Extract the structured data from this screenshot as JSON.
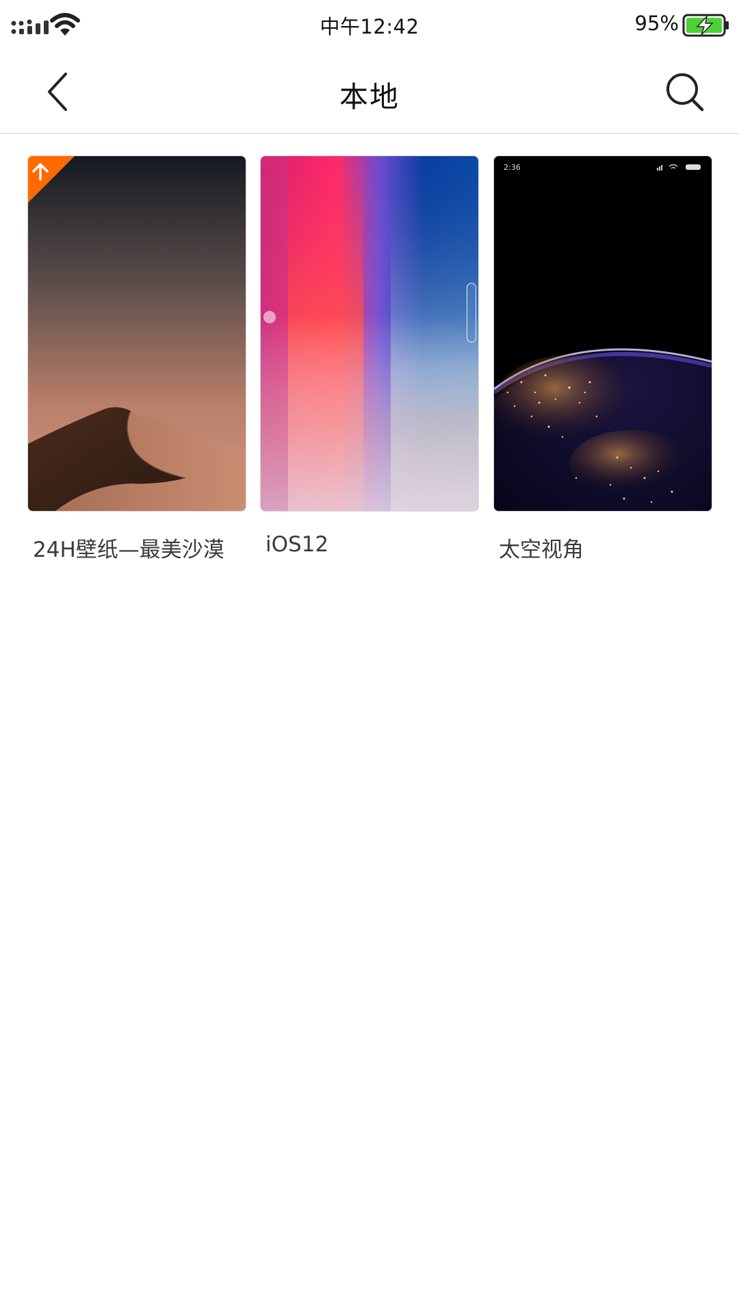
{
  "status_bar": {
    "time": "中午12:42",
    "battery_percent": "95%",
    "icons": [
      "signal-icon",
      "wifi-icon",
      "battery-charging-icon"
    ]
  },
  "nav": {
    "title": "本地",
    "icons": [
      "chevron-left-icon",
      "search-icon"
    ]
  },
  "wallpapers": [
    {
      "title": "24H壁纸—最美沙漠",
      "badge_icon": "arrow-up-icon"
    },
    {
      "title": "iOS12"
    },
    {
      "title": "太空视角",
      "preview_time": "2:36"
    }
  ],
  "colors": {
    "badge": "#ff6a00",
    "battery_fill": "#4cd137",
    "text": "#3a3a3a"
  }
}
